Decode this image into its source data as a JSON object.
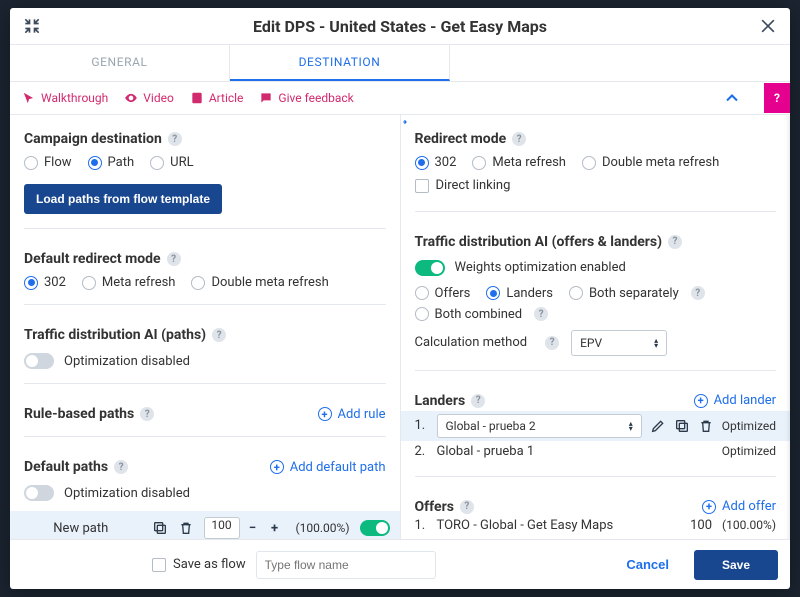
{
  "title": "Edit DPS - United States - Get Easy Maps",
  "tabs": {
    "general": "GENERAL",
    "destination": "DESTINATION"
  },
  "help_links": {
    "walkthrough": "Walkthrough",
    "video": "Video",
    "article": "Article",
    "feedback": "Give feedback"
  },
  "left": {
    "campaign_destination": {
      "heading": "Campaign destination",
      "options": [
        "Flow",
        "Path",
        "URL"
      ],
      "selected": "Path",
      "load_btn": "Load paths from flow template"
    },
    "default_redirect": {
      "heading": "Default redirect mode",
      "options": [
        "302",
        "Meta refresh",
        "Double meta refresh"
      ],
      "selected": "302"
    },
    "tdai_paths": {
      "heading": "Traffic distribution AI (paths)",
      "toggle_label": "Optimization disabled",
      "toggle_on": false
    },
    "rule_based": {
      "heading": "Rule-based paths",
      "add_label": "Add rule"
    },
    "default_paths": {
      "heading": "Default paths",
      "add_label": "Add default path",
      "toggle_label": "Optimization disabled",
      "toggle_on": false,
      "row": {
        "name": "New path",
        "weight": "100",
        "pct": "(100.00%)",
        "enabled": true
      }
    }
  },
  "right": {
    "redirect_mode": {
      "heading": "Redirect mode",
      "options": [
        "302",
        "Meta refresh",
        "Double meta refresh"
      ],
      "selected": "302",
      "direct_linking": "Direct linking"
    },
    "tdai_ol": {
      "heading": "Traffic distribution AI (offers & landers)",
      "toggle_label": "Weights optimization enabled",
      "toggle_on": true,
      "scope_options": [
        "Offers",
        "Landers",
        "Both separately",
        "Both combined"
      ],
      "scope_selected": "Landers",
      "calc_label": "Calculation method",
      "calc_value": "EPV"
    },
    "landers": {
      "heading": "Landers",
      "add_label": "Add lander",
      "items": [
        {
          "idx": "1.",
          "name": "Global - prueba 2",
          "status": "Optimized",
          "selected": true
        },
        {
          "idx": "2.",
          "name": "Global - prueba 1",
          "status": "Optimized",
          "selected": false
        }
      ]
    },
    "offers": {
      "heading": "Offers",
      "add_label": "Add offer",
      "items": [
        {
          "idx": "1.",
          "name": "TORO - Global - Get Easy Maps",
          "weight": "100",
          "pct": "(100.00%)"
        }
      ]
    }
  },
  "footer": {
    "save_as_flow": "Save as flow",
    "flow_name_placeholder": "Type flow name",
    "cancel": "Cancel",
    "save": "Save"
  }
}
